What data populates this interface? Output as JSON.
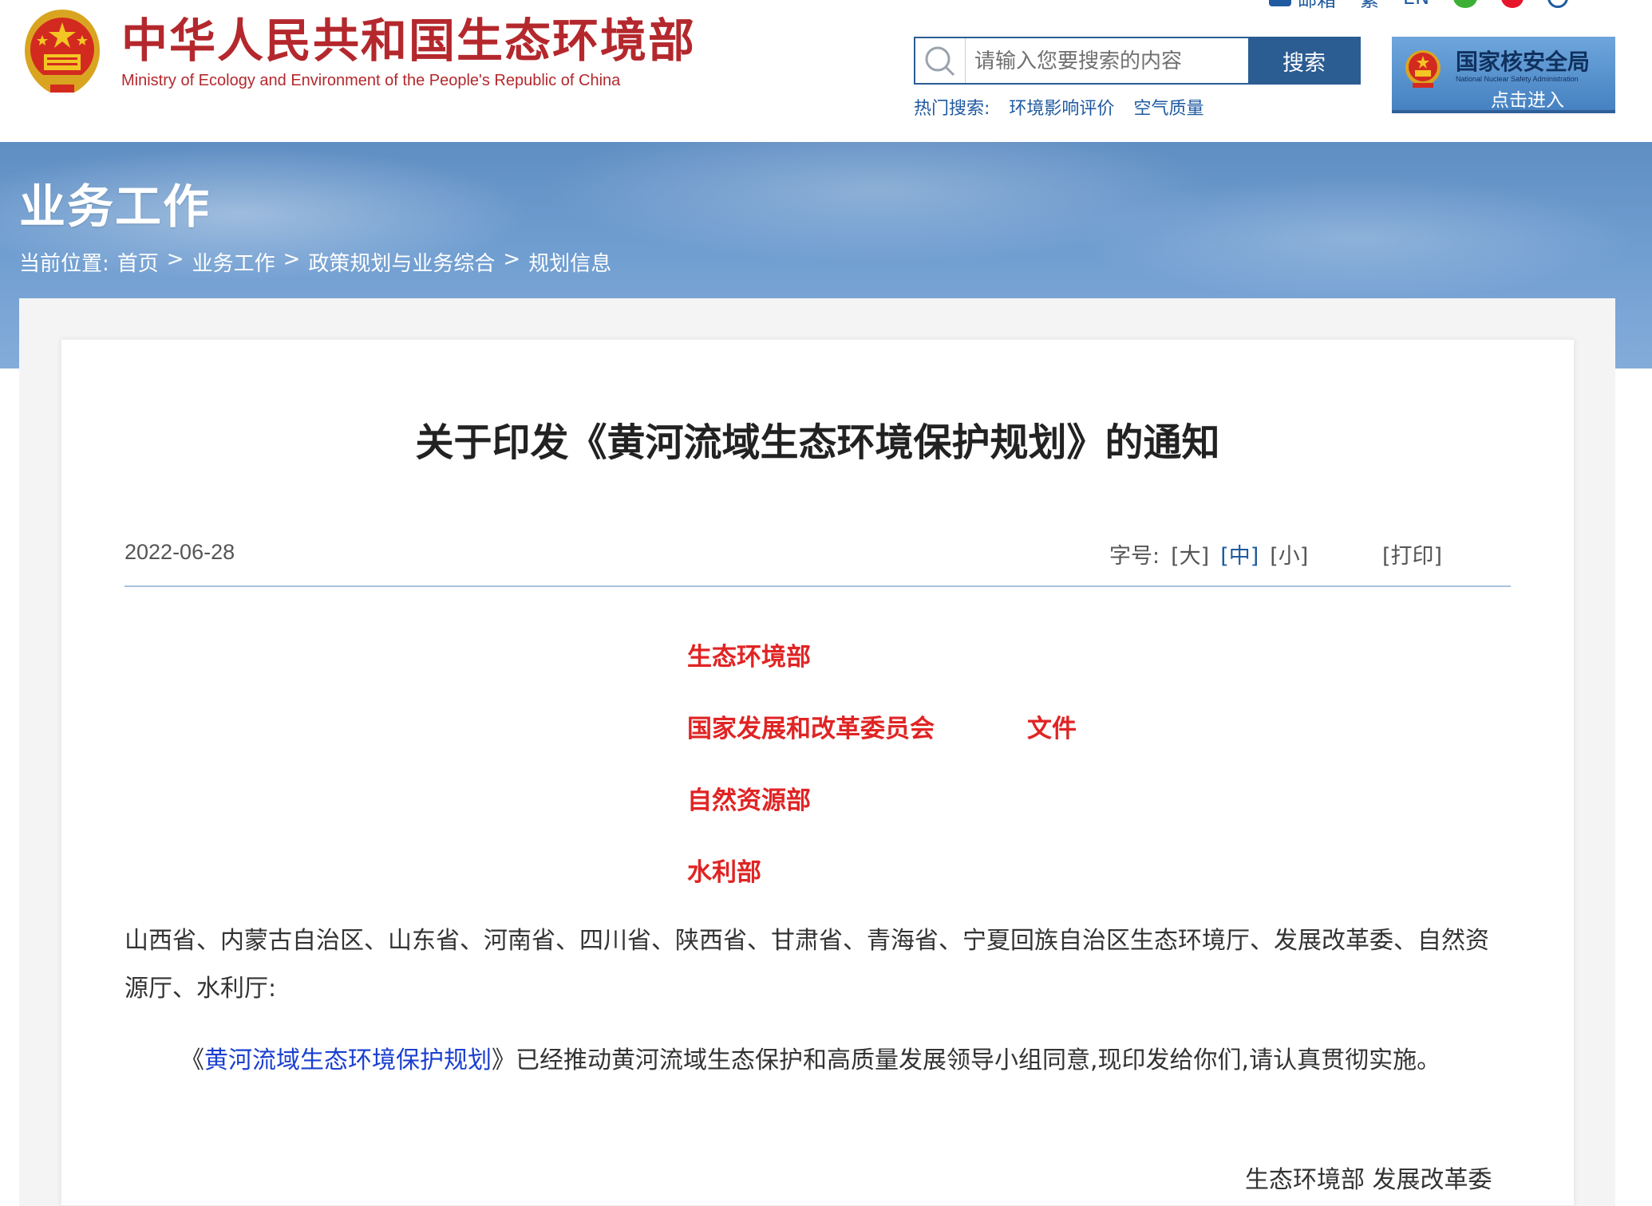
{
  "header": {
    "site_name_cn": "中华人民共和国生态环境部",
    "site_name_en": "Ministry of Ecology and Environment of the People's Republic of China",
    "top_links": [
      {
        "label": "邮箱",
        "icon": "mail-icon"
      },
      {
        "label": "繁",
        "icon": ""
      },
      {
        "label": "EN",
        "icon": ""
      },
      {
        "label": "",
        "icon": "wechat-icon"
      },
      {
        "label": "",
        "icon": "weibo-icon"
      },
      {
        "label": "",
        "icon": "search-icon"
      }
    ],
    "search": {
      "placeholder": "请输入您要搜索的内容",
      "button_label": "搜索",
      "hot_label": "热门搜索:",
      "hot_terms": [
        "环境影响评价",
        "空气质量"
      ]
    },
    "nnsa": {
      "title": "国家核安全局",
      "subtitle_en": "National Nuclear Safety Administration",
      "enter_label": "点击进入"
    },
    "colors": {
      "brand_red": "#b4282d",
      "nav_blue": "#2b5c92",
      "link_blue": "#1f5aa0"
    }
  },
  "banner": {
    "title": "业务工作",
    "breadcrumb_label": "当前位置:",
    "breadcrumb": [
      "首页",
      "业务工作",
      "政策规划与业务综合",
      "规划信息"
    ],
    "separator": ">"
  },
  "article": {
    "title": "关于印发《黄河流域生态环境保护规划》的通知",
    "date": "2022-06-28",
    "font_size_label": "字号:",
    "font_sizes": [
      "[大]",
      "[中]",
      "[小]"
    ],
    "active_font_size": "[中]",
    "print_label": "[打印]",
    "issuers": [
      "生态环境部",
      "国家发展和改革委员会",
      "自然资源部",
      "水利部"
    ],
    "file_word": "文件",
    "recipients": "山西省、内蒙古自治区、山东省、河南省、四川省、陕西省、甘肃省、青海省、宁夏回族自治区生态环境厅、发展改革委、自然资源厅、水利厅:",
    "para1": {
      "prefix": "《",
      "link": "黄河流域生态环境保护规划",
      "suffix": "》已经推动黄河流域生态保护和高质量发展领导小组同意,现印发给你们,请认真贯彻实施。"
    },
    "signature": "生态环境部 发展改革委",
    "colors": {
      "issuer_red": "#e02424",
      "link_blue": "#1a3fd0"
    }
  }
}
